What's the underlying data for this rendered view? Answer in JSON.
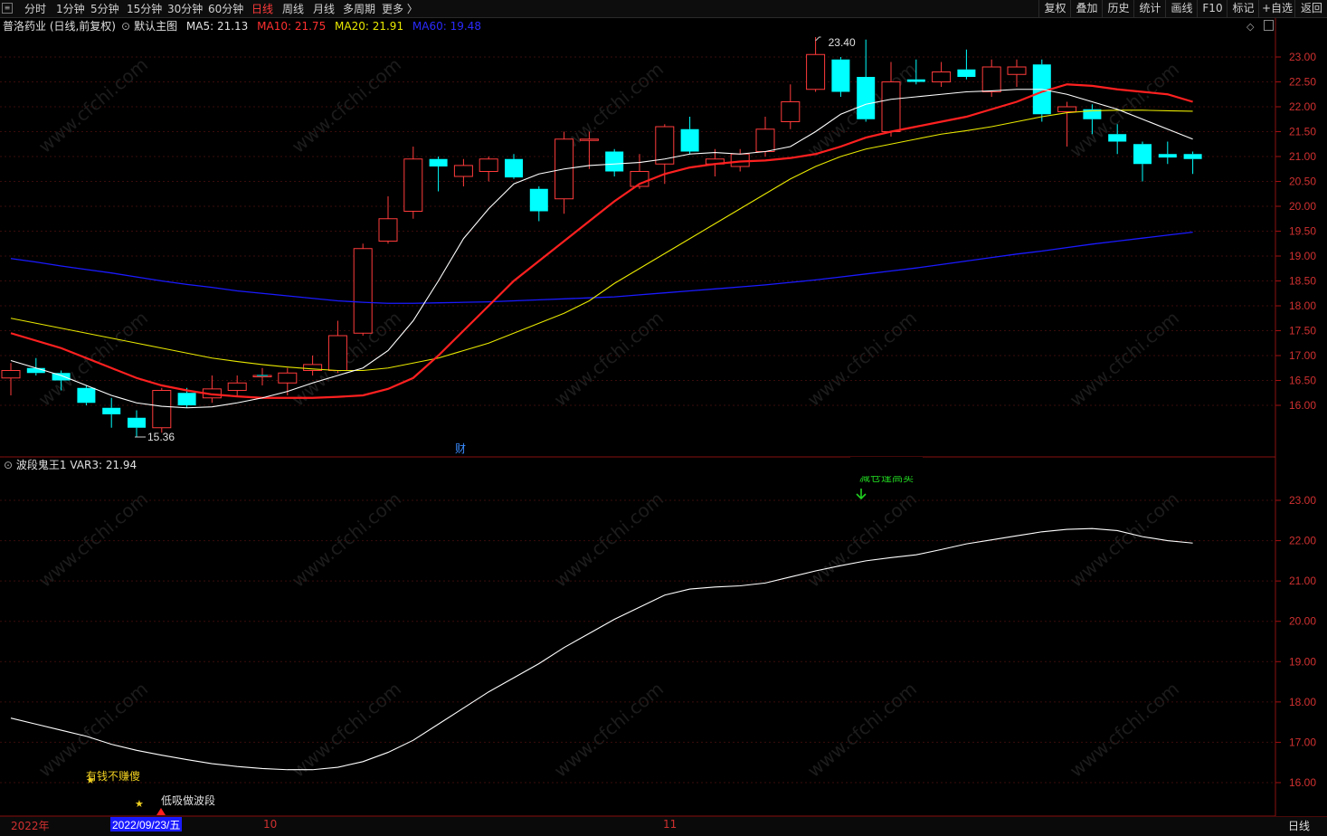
{
  "toolbar": {
    "tabs": [
      "分时",
      "1分钟",
      "5分钟",
      "15分钟",
      "30分钟",
      "60分钟",
      "日线",
      "周线",
      "月线",
      "多周期",
      "更多 〉"
    ],
    "active_tab": "日线",
    "right_tools": [
      "复权",
      "叠加",
      "历史",
      "统计",
      "画线",
      "F10",
      "标记",
      "+自选",
      "返回"
    ]
  },
  "main_chart": {
    "stock": "普洛药业 (日线,前复权)",
    "template": "默认主图",
    "ma5": "MA5: 21.13",
    "ma10": "MA10: 21.75",
    "ma20": "MA20: 21.91",
    "ma60": "MA60: 19.48",
    "high_label": "23.40",
    "low_label": "15.36",
    "finance_marker": "财",
    "y_ticks": [
      "23.00",
      "22.50",
      "22.00",
      "21.50",
      "21.00",
      "20.50",
      "20.00",
      "19.50",
      "19.00",
      "18.50",
      "18.00",
      "17.50",
      "17.00",
      "16.50",
      "16.00"
    ]
  },
  "sub_chart": {
    "indicator": "波段鬼王1",
    "var3": "VAR3: 21.94",
    "signal_top": "减仓逢高卖",
    "signal_star": "有钱不赚傻",
    "signal_buy": "低吸做波段",
    "y_ticks": [
      "23.00",
      "22.00",
      "21.00",
      "20.00",
      "19.00",
      "18.00",
      "17.00",
      "16.00"
    ]
  },
  "time_axis": {
    "year": "2022年",
    "cursor_date": "2022/09/23/五",
    "month_10": "10",
    "month_11": "11",
    "period": "日线"
  },
  "watermark": "www.cfchi.com",
  "colors": {
    "up": "#ff3b3b",
    "down": "#00ffff",
    "ma5": "#ffffff",
    "ma10": "#ff2020",
    "ma20": "#e8e800",
    "ma60": "#1a1aff",
    "axis": "#d03030"
  },
  "chart_data": {
    "type": "candlestick",
    "series": [
      {
        "name": "MA5",
        "color": "#ffffff"
      },
      {
        "name": "MA10",
        "color": "#ff2020"
      },
      {
        "name": "MA20",
        "color": "#e8e800"
      },
      {
        "name": "MA60",
        "color": "#1a1aff"
      }
    ],
    "ylim": [
      15.3,
      23.6
    ],
    "candles": [
      {
        "o": 16.55,
        "c": 16.7,
        "h": 16.85,
        "l": 16.2
      },
      {
        "o": 16.75,
        "c": 16.65,
        "h": 16.95,
        "l": 16.6
      },
      {
        "o": 16.65,
        "c": 16.5,
        "h": 16.7,
        "l": 16.3
      },
      {
        "o": 16.35,
        "c": 16.05,
        "h": 16.4,
        "l": 16.0
      },
      {
        "o": 15.95,
        "c": 15.82,
        "h": 16.15,
        "l": 15.55
      },
      {
        "o": 15.75,
        "c": 15.55,
        "h": 15.9,
        "l": 15.36
      },
      {
        "o": 15.55,
        "c": 16.3,
        "h": 16.35,
        "l": 15.45
      },
      {
        "o": 16.25,
        "c": 16.0,
        "h": 16.35,
        "l": 15.95
      },
      {
        "o": 16.15,
        "c": 16.33,
        "h": 16.6,
        "l": 16.05
      },
      {
        "o": 16.3,
        "c": 16.45,
        "h": 16.6,
        "l": 16.2
      },
      {
        "o": 16.58,
        "c": 16.6,
        "h": 16.75,
        "l": 16.4
      },
      {
        "o": 16.45,
        "c": 16.65,
        "h": 16.75,
        "l": 16.2
      },
      {
        "o": 16.7,
        "c": 16.82,
        "h": 17.0,
        "l": 16.6
      },
      {
        "o": 16.7,
        "c": 17.4,
        "h": 17.7,
        "l": 16.65
      },
      {
        "o": 17.45,
        "c": 19.15,
        "h": 19.25,
        "l": 17.4
      },
      {
        "o": 19.3,
        "c": 19.75,
        "h": 20.2,
        "l": 19.25
      },
      {
        "o": 19.9,
        "c": 20.95,
        "h": 21.2,
        "l": 19.75
      },
      {
        "o": 20.95,
        "c": 20.8,
        "h": 21.0,
        "l": 20.3
      },
      {
        "o": 20.6,
        "c": 20.82,
        "h": 20.95,
        "l": 20.4
      },
      {
        "o": 20.7,
        "c": 20.95,
        "h": 21.0,
        "l": 20.5
      },
      {
        "o": 20.95,
        "c": 20.58,
        "h": 21.05,
        "l": 20.55
      },
      {
        "o": 20.35,
        "c": 19.9,
        "h": 20.4,
        "l": 19.7
      },
      {
        "o": 20.15,
        "c": 21.35,
        "h": 21.5,
        "l": 19.85
      },
      {
        "o": 21.35,
        "c": 21.35,
        "h": 21.5,
        "l": 20.75
      },
      {
        "o": 21.1,
        "c": 20.7,
        "h": 21.15,
        "l": 20.6
      },
      {
        "o": 20.4,
        "c": 20.7,
        "h": 21.05,
        "l": 20.35
      },
      {
        "o": 20.85,
        "c": 21.6,
        "h": 21.65,
        "l": 20.45
      },
      {
        "o": 21.55,
        "c": 21.1,
        "h": 21.8,
        "l": 21.05
      },
      {
        "o": 20.85,
        "c": 20.95,
        "h": 21.15,
        "l": 20.6
      },
      {
        "o": 20.8,
        "c": 21.05,
        "h": 21.15,
        "l": 20.7
      },
      {
        "o": 21.1,
        "c": 21.55,
        "h": 21.8,
        "l": 21.0
      },
      {
        "o": 21.7,
        "c": 22.1,
        "h": 22.45,
        "l": 21.55
      },
      {
        "o": 22.35,
        "c": 23.05,
        "h": 23.4,
        "l": 22.3
      },
      {
        "o": 22.95,
        "c": 22.3,
        "h": 23.0,
        "l": 22.2
      },
      {
        "o": 22.6,
        "c": 21.75,
        "h": 23.35,
        "l": 21.7
      },
      {
        "o": 21.5,
        "c": 22.5,
        "h": 22.9,
        "l": 21.4
      },
      {
        "o": 22.55,
        "c": 22.5,
        "h": 22.95,
        "l": 22.45
      },
      {
        "o": 22.5,
        "c": 22.7,
        "h": 22.9,
        "l": 22.4
      },
      {
        "o": 22.75,
        "c": 22.6,
        "h": 23.15,
        "l": 22.55
      },
      {
        "o": 22.3,
        "c": 22.8,
        "h": 22.95,
        "l": 22.2
      },
      {
        "o": 22.65,
        "c": 22.8,
        "h": 22.95,
        "l": 22.4
      },
      {
        "o": 22.85,
        "c": 21.85,
        "h": 22.95,
        "l": 21.7
      },
      {
        "o": 21.9,
        "c": 22.0,
        "h": 22.1,
        "l": 21.2
      },
      {
        "o": 21.95,
        "c": 21.75,
        "h": 22.05,
        "l": 21.45
      },
      {
        "o": 21.45,
        "c": 21.3,
        "h": 21.65,
        "l": 21.05
      },
      {
        "o": 21.25,
        "c": 20.85,
        "h": 21.3,
        "l": 20.5
      },
      {
        "o": 21.05,
        "c": 20.98,
        "h": 21.3,
        "l": 20.85
      },
      {
        "o": 21.05,
        "c": 20.95,
        "h": 21.1,
        "l": 20.65
      }
    ],
    "ma5": [
      16.9,
      16.75,
      16.6,
      16.4,
      16.2,
      16.05,
      15.98,
      15.95,
      15.97,
      16.05,
      16.15,
      16.28,
      16.45,
      16.6,
      16.75,
      17.1,
      17.7,
      18.5,
      19.35,
      19.95,
      20.45,
      20.65,
      20.75,
      20.82,
      20.85,
      20.88,
      20.95,
      21.05,
      21.08,
      21.05,
      21.1,
      21.2,
      21.5,
      21.85,
      22.05,
      22.15,
      22.2,
      22.25,
      22.3,
      22.32,
      22.35,
      22.35,
      22.25,
      22.1,
      21.95,
      21.75,
      21.55,
      21.35
    ],
    "ma10": [
      17.45,
      17.3,
      17.15,
      16.95,
      16.75,
      16.55,
      16.4,
      16.3,
      16.22,
      16.18,
      16.15,
      16.15,
      16.15,
      16.17,
      16.2,
      16.33,
      16.55,
      17.0,
      17.5,
      18.0,
      18.5,
      18.9,
      19.3,
      19.7,
      20.1,
      20.45,
      20.65,
      20.78,
      20.85,
      20.9,
      20.92,
      20.97,
      21.05,
      21.2,
      21.38,
      21.5,
      21.6,
      21.7,
      21.8,
      21.95,
      22.1,
      22.3,
      22.45,
      22.42,
      22.35,
      22.3,
      22.25,
      22.1
    ],
    "ma20": [
      17.75,
      17.65,
      17.55,
      17.45,
      17.35,
      17.25,
      17.15,
      17.05,
      16.95,
      16.88,
      16.82,
      16.77,
      16.73,
      16.7,
      16.7,
      16.75,
      16.85,
      16.95,
      17.1,
      17.25,
      17.45,
      17.65,
      17.85,
      18.1,
      18.45,
      18.75,
      19.05,
      19.35,
      19.65,
      19.95,
      20.25,
      20.55,
      20.8,
      21.0,
      21.15,
      21.25,
      21.35,
      21.45,
      21.52,
      21.6,
      21.7,
      21.8,
      21.88,
      21.92,
      21.93,
      21.93,
      21.92,
      21.91
    ],
    "ma60": [
      18.95,
      18.88,
      18.8,
      18.73,
      18.66,
      18.58,
      18.5,
      18.43,
      18.37,
      18.3,
      18.25,
      18.2,
      18.15,
      18.1,
      18.07,
      18.05,
      18.05,
      18.06,
      18.07,
      18.08,
      18.1,
      18.12,
      18.14,
      18.16,
      18.18,
      18.22,
      18.26,
      18.3,
      18.34,
      18.38,
      18.42,
      18.47,
      18.52,
      18.58,
      18.64,
      18.7,
      18.76,
      18.83,
      18.9,
      18.97,
      19.04,
      19.1,
      19.17,
      19.24,
      19.3,
      19.36,
      19.42,
      19.48
    ],
    "var3": [
      17.6,
      17.45,
      17.3,
      17.15,
      16.95,
      16.8,
      16.68,
      16.57,
      16.47,
      16.4,
      16.35,
      16.32,
      16.32,
      16.38,
      16.52,
      16.75,
      17.05,
      17.45,
      17.85,
      18.25,
      18.6,
      18.95,
      19.35,
      19.7,
      20.05,
      20.35,
      20.65,
      20.8,
      20.85,
      20.88,
      20.95,
      21.1,
      21.25,
      21.38,
      21.5,
      21.58,
      21.65,
      21.78,
      21.92,
      22.02,
      22.12,
      22.22,
      22.28,
      22.3,
      22.25,
      22.1,
      22.0,
      21.94
    ]
  }
}
